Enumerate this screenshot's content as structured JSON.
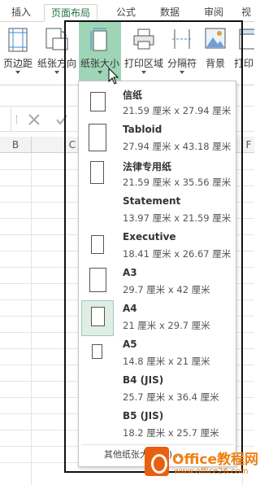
{
  "ribbon_tabs": [
    {
      "label": "插入"
    },
    {
      "label": "页面布局"
    },
    {
      "label": "公式"
    },
    {
      "label": "数据"
    },
    {
      "label": "审阅"
    },
    {
      "label": "视"
    }
  ],
  "ribbon_buttons": {
    "margins": "页边距",
    "orientation": "纸张方向",
    "size": "纸张大小",
    "print_area": "打印区域",
    "breaks": "分隔符",
    "background": "背景",
    "print_titles": "打印"
  },
  "columns": [
    "B",
    "C",
    "F"
  ],
  "paper_sizes": [
    {
      "name": "信纸",
      "dims": "21.59 厘米 x 27.94 厘米"
    },
    {
      "name": "Tabloid",
      "dims": "27.94 厘米 x 43.18 厘米"
    },
    {
      "name": "法律专用纸",
      "dims": "21.59 厘米 x 35.56 厘米"
    },
    {
      "name": "Statement",
      "dims": "13.97 厘米 x 21.59 厘米"
    },
    {
      "name": "Executive",
      "dims": "18.41 厘米 x 26.67 厘米"
    },
    {
      "name": "A3",
      "dims": "29.7 厘米 x 42 厘米"
    },
    {
      "name": "A4",
      "dims": "21 厘米 x 29.7 厘米"
    },
    {
      "name": "A5",
      "dims": "14.8 厘米 x 21 厘米"
    },
    {
      "name": "B4 (JIS)",
      "dims": "25.7 厘米 x 36.4 厘米"
    },
    {
      "name": "B5 (JIS)",
      "dims": "18.2 厘米 x 25.7 厘米"
    }
  ],
  "selected_paper": "A4",
  "more_sizes": "其他纸张大小(M)...",
  "watermark": {
    "brand": "Office教程网",
    "url": "www.office26.com"
  },
  "colors": {
    "accent_green": "#217346",
    "pressed_bg": "#9fd5b7",
    "watermark_orange": "#e8600f"
  }
}
